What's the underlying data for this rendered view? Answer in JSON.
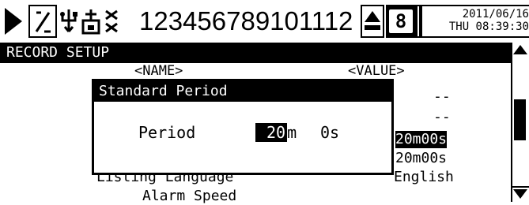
{
  "status_bar": {
    "channels": "123456789101112",
    "chip_label": "8",
    "date": "2011/06/16",
    "time": "THU 08:39:30"
  },
  "header": {
    "title": "RECORD SETUP"
  },
  "table": {
    "col_name": "<NAME>",
    "col_value": "<VALUE>",
    "rows": [
      {
        "name": "",
        "value": "--"
      },
      {
        "name": "",
        "value": "--"
      },
      {
        "name": "",
        "value": "20m00s",
        "selected": true
      },
      {
        "name": "",
        "value": "20m00s"
      },
      {
        "name": "Listing Language",
        "value": "English"
      },
      {
        "name": "Alarm Speed",
        "value": ""
      }
    ]
  },
  "dialog": {
    "title": "Standard Period",
    "label": "Period",
    "minutes_value": "20",
    "minutes_unit": "m",
    "seconds_value": "0",
    "seconds_unit": "s"
  }
}
